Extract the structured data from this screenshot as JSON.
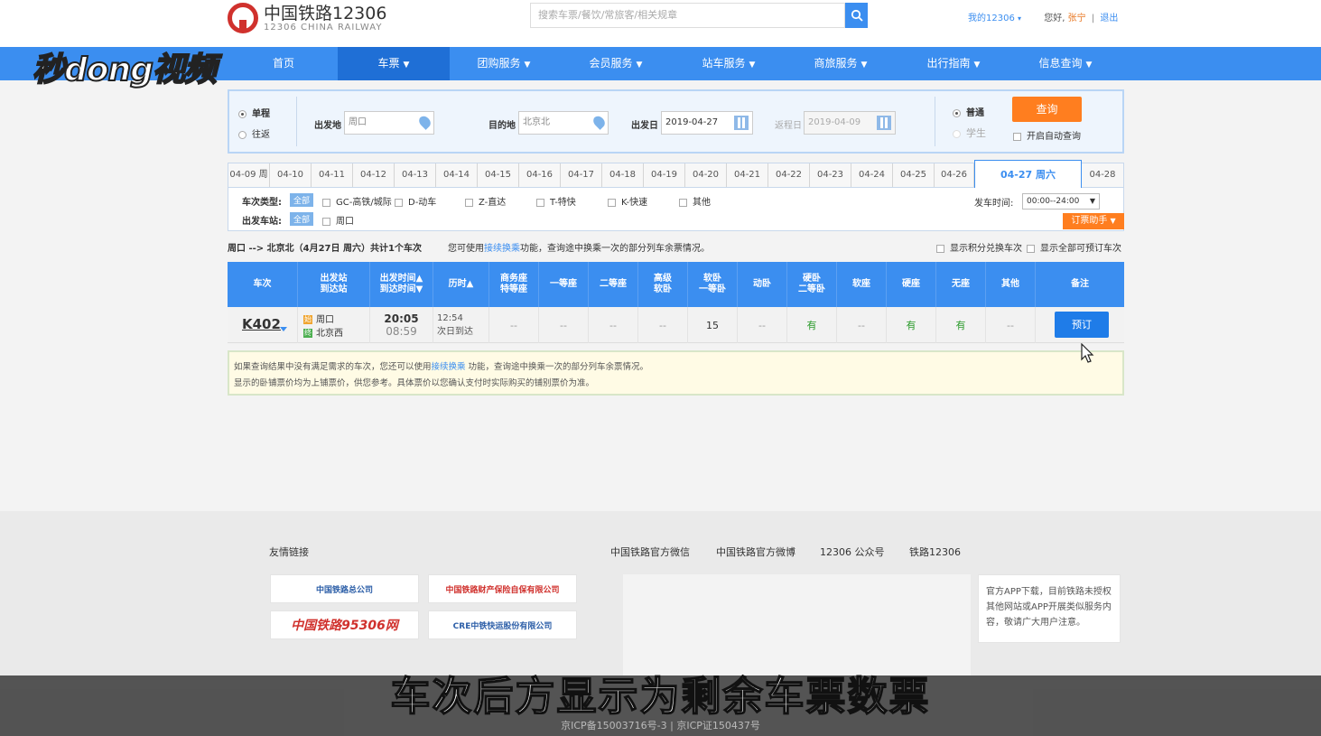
{
  "header": {
    "logo_cn": "中国铁路12306",
    "logo_en": "12306 CHINA RAILWAY",
    "search_placeholder": "搜索车票/餐饮/常旅客/相关规章",
    "my12306": "我的12306",
    "hello": "您好,",
    "username": "张宁",
    "sep": "|",
    "logout": "退出"
  },
  "watermark": "秒dong视频",
  "nav": [
    {
      "label": "首页"
    },
    {
      "label": "车票"
    },
    {
      "label": "团购服务"
    },
    {
      "label": "会员服务"
    },
    {
      "label": "站车服务"
    },
    {
      "label": "商旅服务"
    },
    {
      "label": "出行指南"
    },
    {
      "label": "信息查询"
    }
  ],
  "query": {
    "oneway": "单程",
    "roundtrip": "往返",
    "from_label": "出发地",
    "from_value": "周口",
    "to_label": "目的地",
    "to_value": "北京北",
    "depart_label": "出发日",
    "depart_value": "2019-04-27",
    "return_label": "返程日",
    "return_value": "2019-04-09",
    "normal": "普通",
    "student": "学生",
    "query_btn": "查询",
    "auto_query": "开启自动查询"
  },
  "dates": [
    "04-09 周",
    "04-10",
    "04-11",
    "04-12",
    "04-13",
    "04-14",
    "04-15",
    "04-16",
    "04-17",
    "04-18",
    "04-19",
    "04-20",
    "04-21",
    "04-22",
    "04-23",
    "04-24",
    "04-25",
    "04-26",
    "04-27 周六",
    "04-28"
  ],
  "filters": {
    "type_label": "车次类型:",
    "all": "全部",
    "types": [
      "GC-高铁/城际",
      "D-动车",
      "Z-直达",
      "T-特快",
      "K-快速",
      "其他"
    ],
    "station_label": "出发车站:",
    "stations": [
      "周口"
    ],
    "time_label": "发车时间:",
    "time_value": "00:00--24:00",
    "helper": "订票助手"
  },
  "summary": {
    "route": "周口 --> 北京北（4月27日 周六）共计1个车次",
    "hint_pre": "您可使用",
    "hint_link": "接续换乘",
    "hint_post": "功能，查询途中换乘一次的部分列车余票情况。",
    "opt1": "显示积分兑换车次",
    "opt2": "显示全部可预订车次"
  },
  "table": {
    "headers": [
      "车次",
      "出发站\n到达站",
      "出发时间▲\n到达时间▼",
      "历时▲",
      "商务座\n特等座",
      "一等座",
      "二等座",
      "高级\n软卧",
      "软卧\n一等卧",
      "动卧",
      "硬卧\n二等卧",
      "软座",
      "硬座",
      "无座",
      "其他",
      "备注"
    ],
    "row": {
      "train": "K402",
      "from": "周口",
      "to": "北京西",
      "from_tag": "始",
      "to_tag": "终",
      "dep_time": "20:05",
      "arr_time": "08:59",
      "duration": "12:54",
      "duration_note": "次日到达",
      "cells": [
        "--",
        "--",
        "--",
        "--",
        "15",
        "--",
        "有",
        "--",
        "有",
        "有",
        "--"
      ],
      "book": "预订"
    }
  },
  "notice": {
    "line1_pre": "如果查询结果中没有满足需求的车次，您还可以使用",
    "line1_link": "接续换乘",
    "line1_post": " 功能，查询途中换乘一次的部分列车余票情况。",
    "line2": "显示的卧铺票价均为上铺票价，供您参考。具体票价以您确认支付时实际购买的铺别票价为准。"
  },
  "footer": {
    "links_title": "友情链接",
    "social": [
      "中国铁路官方微信",
      "中国铁路官方微博",
      "12306 公众号",
      "铁路12306"
    ],
    "partners": [
      "中国铁路总公司",
      "中国铁路财产保险自保有限公司",
      "中国铁路95306网",
      "CRE中铁快运股份有限公司"
    ],
    "app_note": "官方APP下载，目前铁路未授权其他网站或APP开展类似服务内容，敬请广大用户注意。",
    "icp": "京ICP备15003716号-3  |  京ICP证150437号"
  },
  "subtitle": "车次后方显示为剩余车票数票"
}
